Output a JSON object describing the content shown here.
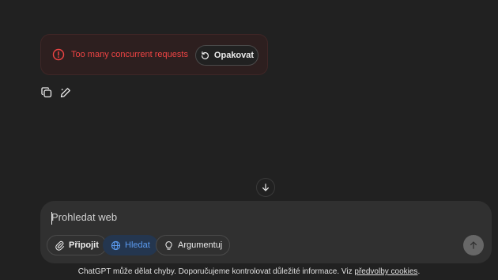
{
  "error": {
    "message": "Too many concurrent requests",
    "retry_label": "Opakovat",
    "icon": "alert-circle-icon",
    "color": "#ef4444"
  },
  "message_actions": {
    "copy_icon": "copy-icon",
    "edit_icon": "edit-icon"
  },
  "composer": {
    "placeholder": "Prohledat web",
    "attach_label": "Připojit",
    "search_label": "Hledat",
    "reason_label": "Argumentuj",
    "search_active_color": "#5b9bf0"
  },
  "footer": {
    "text": "ChatGPT může dělat chyby. Doporučujeme kontrolovat důležité informace. Viz ",
    "link_label": "předvolby cookies",
    "suffix": "."
  }
}
